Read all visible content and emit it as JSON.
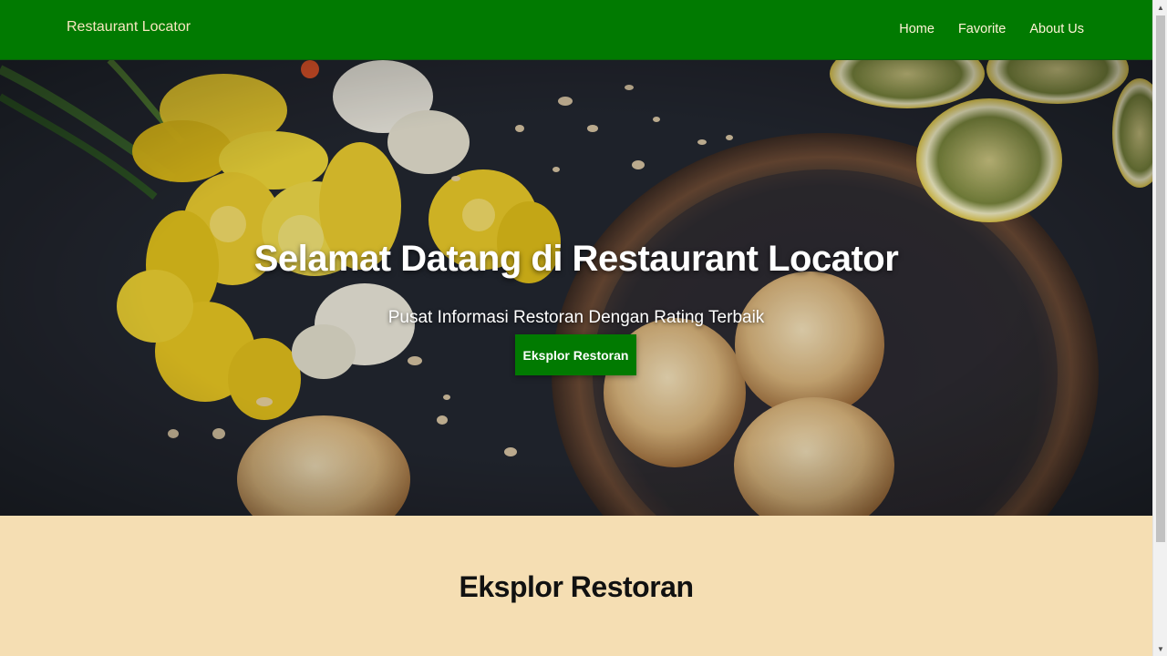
{
  "navbar": {
    "brand": "Restaurant Locator",
    "links": [
      {
        "label": "Home"
      },
      {
        "label": "Favorite"
      },
      {
        "label": "About Us"
      }
    ]
  },
  "hero": {
    "title": "Selamat Datang di Restaurant Locator",
    "subtitle": "Pusat Informasi Restoran Dengan Rating Terbaik",
    "cta_label": "Eksplor Restoran"
  },
  "section": {
    "title": "Eksplor Restoran"
  },
  "colors": {
    "brand_green": "#017a01",
    "page_background": "#f5deb3"
  },
  "scrollbar": {
    "up_icon": "scroll-up-arrow-icon",
    "down_icon": "scroll-down-arrow-icon"
  }
}
